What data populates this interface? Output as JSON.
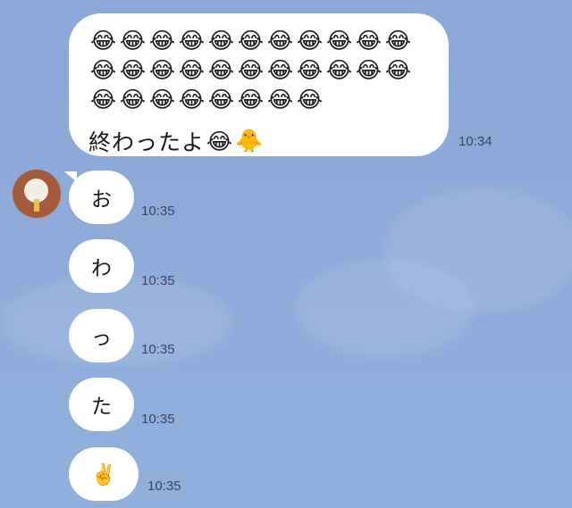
{
  "background": {
    "color": "#8daad9"
  },
  "messages": {
    "first": {
      "emoji_rows": [
        [
          "😂",
          "😂",
          "😂",
          "😂",
          "😂",
          "😂",
          "😂",
          "😂",
          "😂",
          "😂",
          "😂"
        ],
        [
          "😂",
          "😂",
          "😂",
          "😂",
          "😂",
          "😂",
          "😂",
          "😂",
          "😂",
          "😂",
          "😂"
        ],
        [
          "😂",
          "😂",
          "😂",
          "😂",
          "😂",
          "😂",
          "😂",
          "😂"
        ]
      ],
      "text": "終わったよ",
      "trailing_emoji": [
        "😂",
        "🐥"
      ],
      "time": "10:34"
    },
    "received": [
      {
        "text": "お",
        "time": "10:35"
      },
      {
        "text": "わ",
        "time": "10:35"
      },
      {
        "text": "っ",
        "time": "10:35"
      },
      {
        "text": "た",
        "time": "10:35"
      },
      {
        "text": "✌️",
        "time": "10:35"
      }
    ]
  },
  "avatar": {
    "icon": "popsicle-avatar",
    "color": "#a55a3a"
  }
}
